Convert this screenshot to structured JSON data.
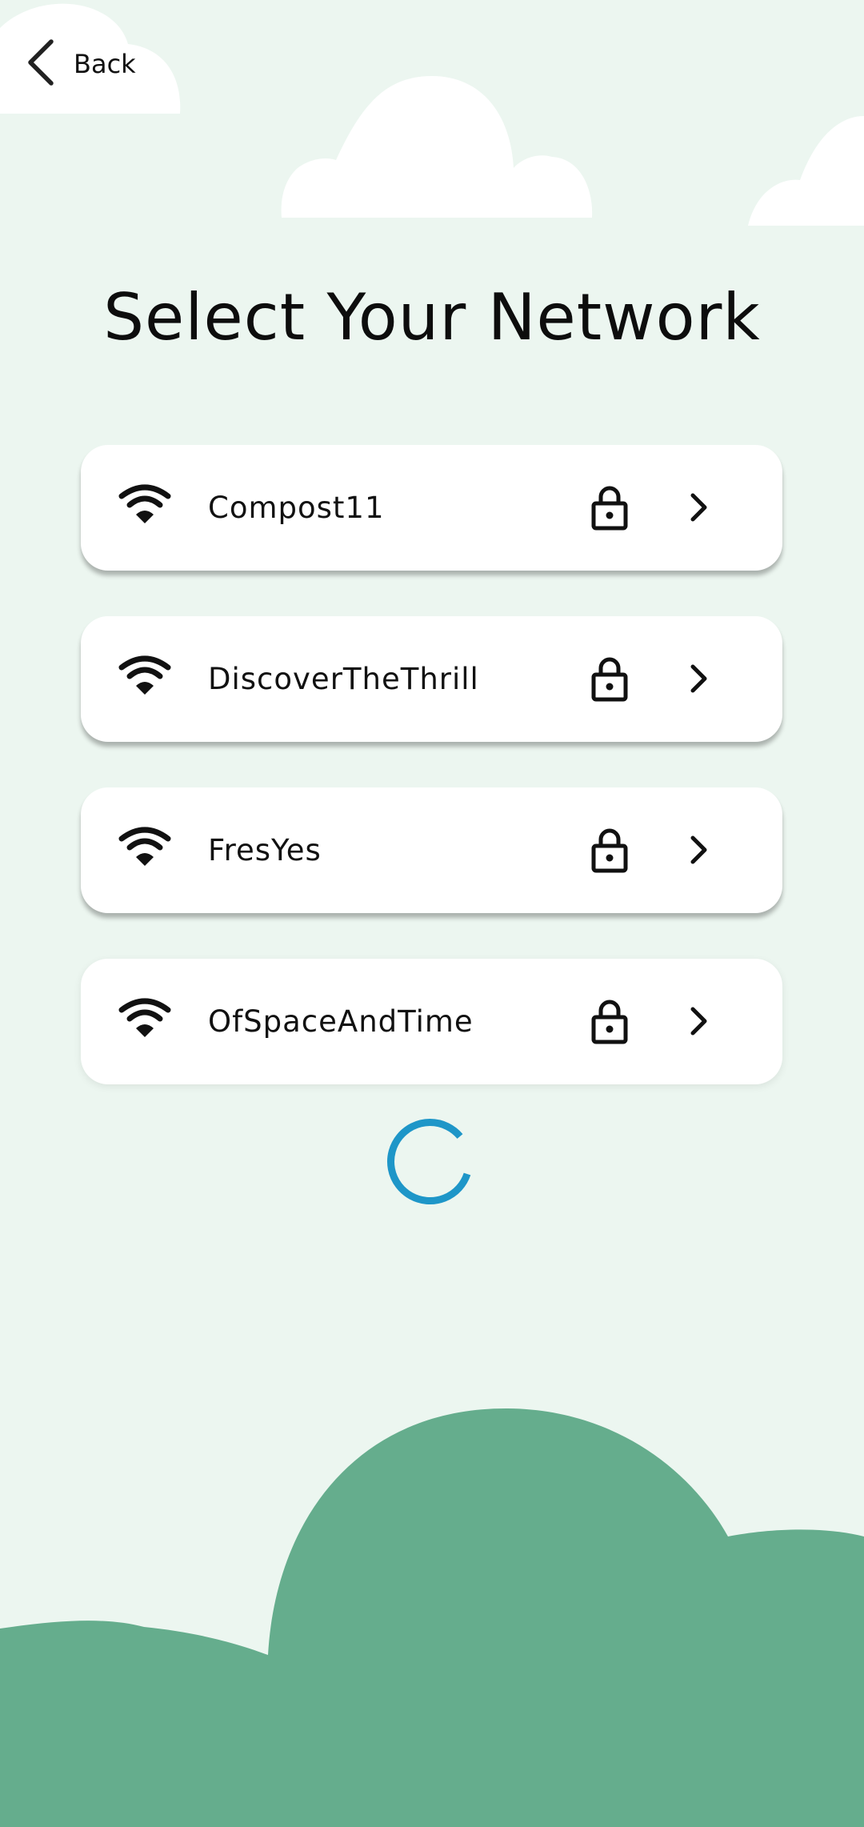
{
  "header": {
    "back_label": "Back"
  },
  "page": {
    "title": "Select Your Network"
  },
  "networks": [
    {
      "name": "Compost11",
      "secured": true
    },
    {
      "name": "DiscoverTheThrill",
      "secured": true
    },
    {
      "name": "FresYes",
      "secured": true
    },
    {
      "name": "OfSpaceAndTime",
      "secured": true
    }
  ],
  "status": {
    "loading": true
  },
  "colors": {
    "background": "#ecf6f0",
    "hill": "#65ad8d",
    "spinner": "#1e96c8",
    "cloud": "#ffffff"
  },
  "icons": [
    "chevron-left-icon",
    "wifi-icon",
    "lock-icon",
    "chevron-right-icon",
    "loading-spinner-icon"
  ]
}
